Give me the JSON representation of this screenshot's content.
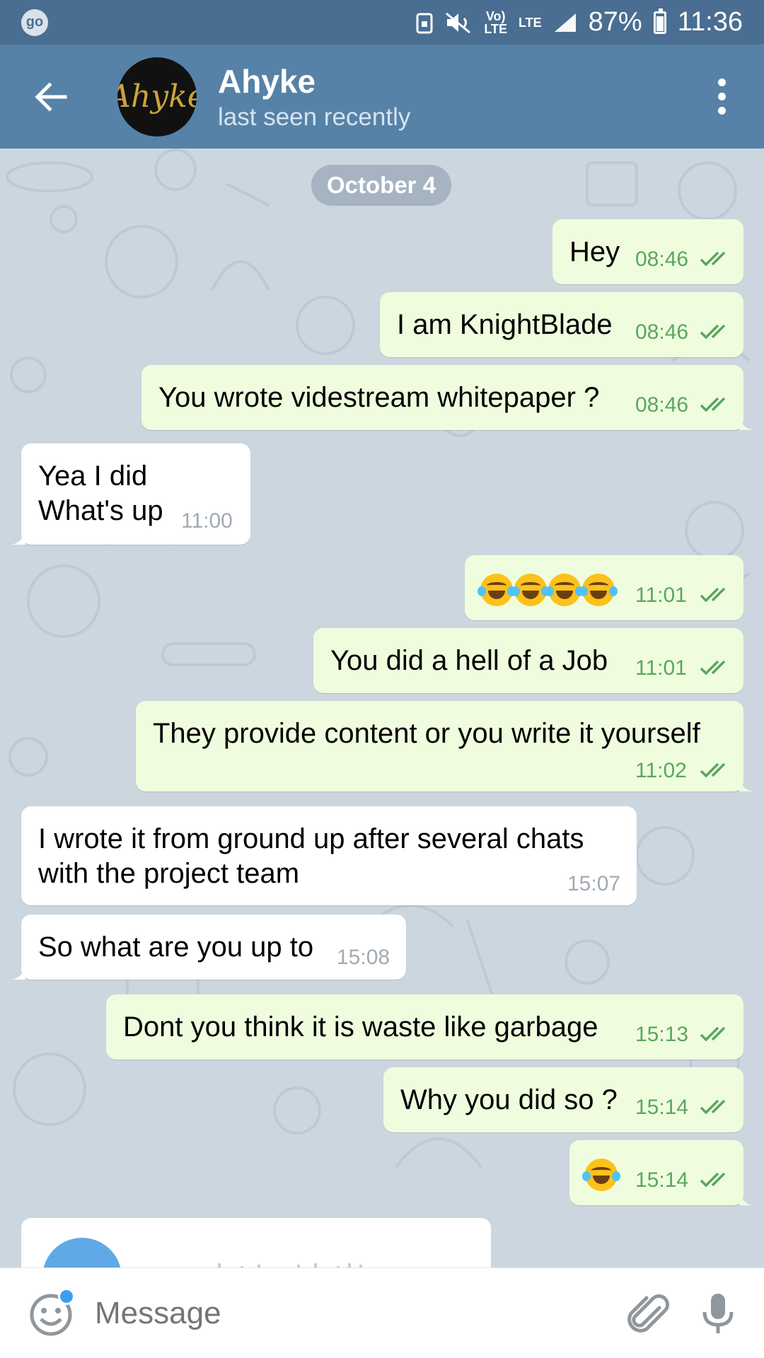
{
  "status_bar": {
    "left_badge": "go",
    "volte": "Vo)\nLTE",
    "lte": "LTE",
    "battery": "87%",
    "time": "11:36"
  },
  "header": {
    "back_icon": "arrow-left-icon",
    "avatar_text": "Ahyke",
    "title": "Ahyke",
    "subtitle": "last seen recently",
    "menu_icon": "more-vertical-icon"
  },
  "date_label": "October 4",
  "messages": [
    {
      "dir": "out",
      "text": "Hey",
      "time": "08:46"
    },
    {
      "dir": "out",
      "text": "I am KnightBlade",
      "time": "08:46"
    },
    {
      "dir": "out",
      "text": "You wrote videstream whitepaper ?",
      "time": "08:46"
    },
    {
      "dir": "in",
      "text": "Yea I did\nWhat's up",
      "time": "11:00"
    },
    {
      "dir": "out",
      "text": "😂😂😂😂",
      "time": "11:01"
    },
    {
      "dir": "out",
      "text": "You did a hell of a Job",
      "time": "11:01"
    },
    {
      "dir": "out",
      "text": "They provide content or you write it yourself",
      "time": "11:02"
    },
    {
      "dir": "in",
      "text": "I wrote it from ground up after several chats\nwith the project team",
      "time": "15:07"
    },
    {
      "dir": "in",
      "text": "So what are you up to",
      "time": "15:08"
    },
    {
      "dir": "out",
      "text": "Dont you think it is waste like garbage",
      "time": "15:13"
    },
    {
      "dir": "out",
      "text": "Why you did so ?",
      "time": "15:14"
    },
    {
      "dir": "out",
      "text": "😂",
      "time": "15:14"
    }
  ],
  "input": {
    "placeholder": "Message",
    "emoji_icon": "emoji-smile-icon",
    "attach_icon": "paperclip-icon",
    "mic_icon": "microphone-icon"
  },
  "colors": {
    "header": "#5682a8",
    "status_bar": "#4a6e91",
    "outgoing_bubble": "#effdde",
    "incoming_bubble": "#ffffff",
    "time_out": "#5aa660"
  }
}
